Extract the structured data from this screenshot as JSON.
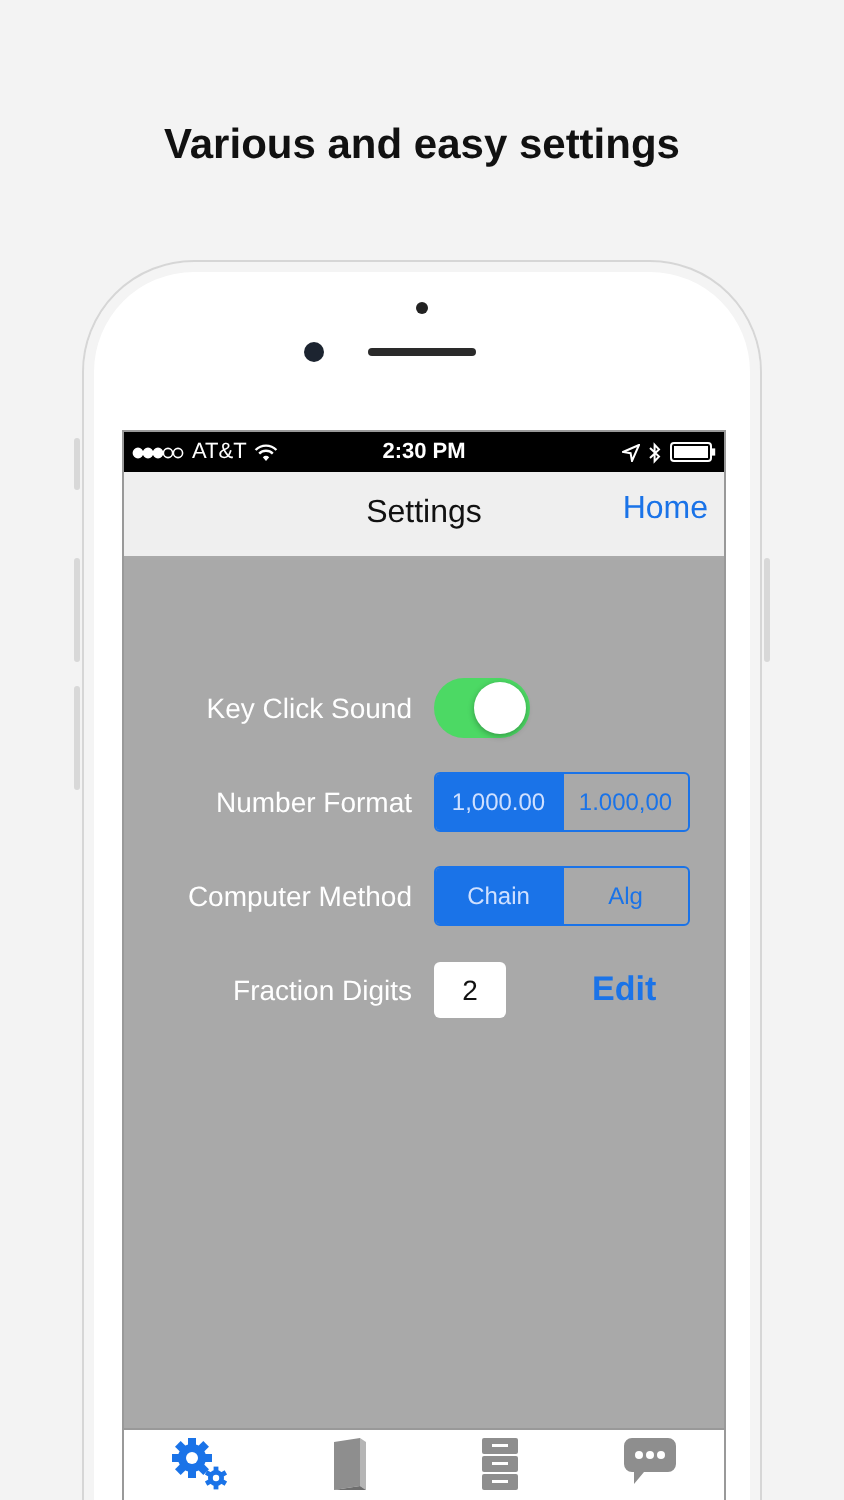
{
  "headline": "Various and easy settings",
  "status_bar": {
    "carrier": "AT&T",
    "time": "2:30 PM"
  },
  "nav": {
    "title": "Settings",
    "action": "Home"
  },
  "settings": [
    {
      "kind": "toggle",
      "label": "Key Click Sound",
      "on": true
    },
    {
      "kind": "segmented",
      "label": "Number Format",
      "options": [
        {
          "label": "1,000.00",
          "selected": true
        },
        {
          "label": "1.000,00",
          "selected": false
        }
      ]
    },
    {
      "kind": "segmented",
      "label": "Computer Method",
      "options": [
        {
          "label": "Chain",
          "selected": true
        },
        {
          "label": "Alg",
          "selected": false
        }
      ]
    },
    {
      "kind": "field",
      "label": "Fraction Digits",
      "value": "2",
      "action": "Edit"
    }
  ],
  "tab_bar": [
    {
      "kind": "gears",
      "selected": true
    },
    {
      "kind": "book",
      "selected": false
    },
    {
      "kind": "cabinet",
      "selected": false
    },
    {
      "kind": "chat",
      "selected": false
    }
  ]
}
